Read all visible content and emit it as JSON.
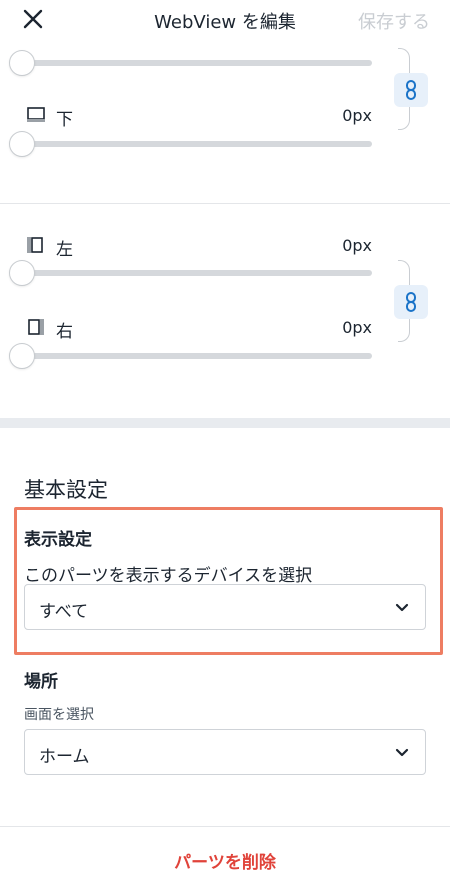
{
  "header": {
    "title": "WebView を編集",
    "save_label": "保存する"
  },
  "spacing": {
    "bottom": {
      "label": "下",
      "value": "0px"
    },
    "left": {
      "label": "左",
      "value": "0px"
    },
    "right": {
      "label": "右",
      "value": "0px"
    }
  },
  "basic_settings": {
    "title": "基本設定",
    "display": {
      "label": "表示設定",
      "description": "このパーツを表示するデバイスを選択",
      "selected": "すべて"
    },
    "location": {
      "label": "場所",
      "description": "画面を選択",
      "selected": "ホーム"
    }
  },
  "footer": {
    "delete_label": "パーツを削除"
  },
  "colors": {
    "accent": "#1a73c8",
    "danger": "#e0433a",
    "highlight": "#ee7d62"
  }
}
